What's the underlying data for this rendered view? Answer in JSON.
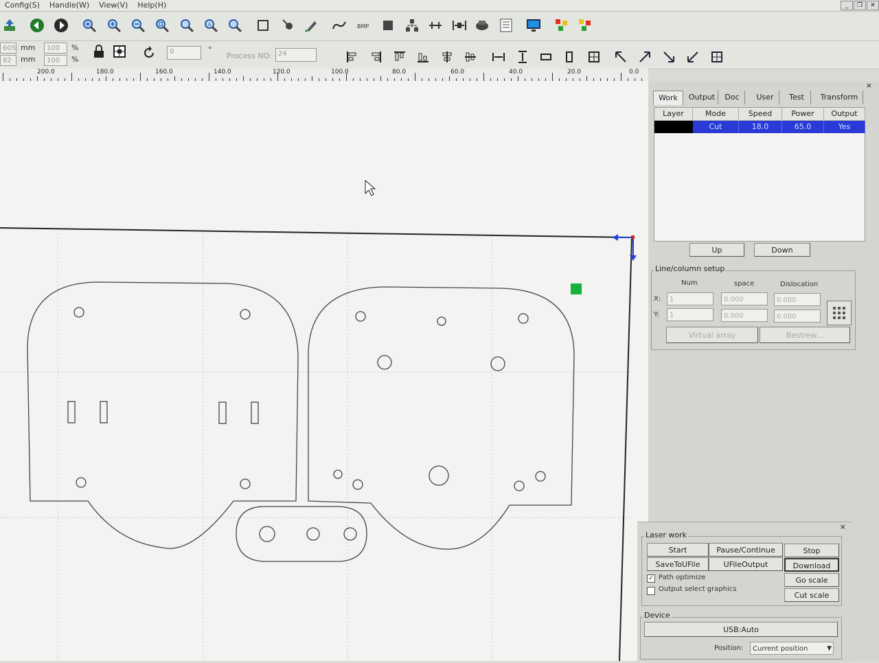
{
  "menu": [
    "Config(S)",
    "Handle(W)",
    "View(V)",
    "Help(H)"
  ],
  "window_controls": [
    "_",
    "❐",
    "✕"
  ],
  "toolbar2": {
    "x_value": "605",
    "y_value": "82",
    "unit_mm": "mm",
    "scale_x": "100",
    "scale_y": "100",
    "pct": "%",
    "angle_value": "0",
    "degree": "°",
    "process_no_label": "Process NO:",
    "process_no_value": "24"
  },
  "ruler": {
    "labels": [
      "200.0",
      "180.0",
      "160.0",
      "140.0",
      "120.0",
      "100.0",
      "80.0",
      "60.0",
      "40.0",
      "20.0",
      "0.0"
    ]
  },
  "panel": {
    "tabs": [
      "Work",
      "Output",
      "Doc",
      "User",
      "Test",
      "Transform"
    ],
    "active_tab": "Work",
    "table": {
      "headers": [
        "Layer",
        "Mode",
        "Speed",
        "Power",
        "Output"
      ],
      "rows": [
        {
          "mode": "Cut",
          "speed": "18.0",
          "power": "65.0",
          "output": "Yes"
        }
      ]
    },
    "up": "Up",
    "down": "Down",
    "line_column_title": "Line/column setup",
    "col_num": "Num",
    "col_space": "space",
    "col_dislocation": "Dislocation",
    "x_label": "X:",
    "y_label": "Y:",
    "x_num": "1",
    "x_space": "0.000",
    "x_disloc": "0.000",
    "y_num": "1",
    "y_space": "0.000",
    "y_disloc": "0.000",
    "virtual_array": "Virtual array",
    "bestrew": "Bestrew..."
  },
  "laser_work": {
    "title": "Laser work",
    "start": "Start",
    "pause": "Pause/Continue",
    "stop": "Stop",
    "save_to_ufile": "SaveToUFile",
    "ufile_output": "UFileOutput",
    "download": "Download",
    "path_optimize": "Path optimize",
    "path_optimize_checked": true,
    "output_select": "Output select graphics",
    "output_select_checked": false,
    "go_scale": "Go scale",
    "cut_scale": "Cut scale"
  },
  "device": {
    "title": "Device",
    "usb": "USB:Auto",
    "position_label": "Position:",
    "position_value": "Current position"
  },
  "colors": {
    "selection_blue": "#2a3ad6",
    "origin_green": "#18b23a",
    "origin_arrow_blue": "#2440e0"
  }
}
